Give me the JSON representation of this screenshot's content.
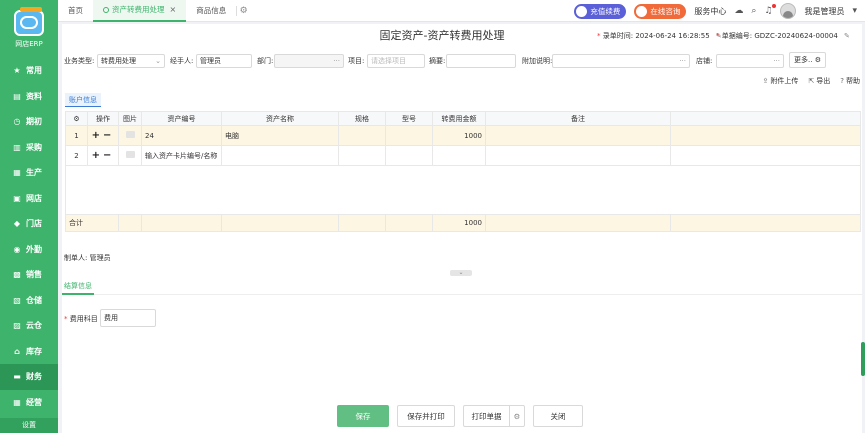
{
  "app": {
    "logo_text": "网店ERP",
    "settings_label": "设置"
  },
  "sidebar": {
    "items": [
      {
        "label": "常用",
        "icon": "star-icon",
        "glyph": "★"
      },
      {
        "label": "资料",
        "icon": "book-icon",
        "glyph": "▤"
      },
      {
        "label": "期初",
        "icon": "clock-icon",
        "glyph": "◷"
      },
      {
        "label": "采购",
        "icon": "cart-icon",
        "glyph": "▥"
      },
      {
        "label": "生产",
        "icon": "factory-icon",
        "glyph": "▦"
      },
      {
        "label": "网店",
        "icon": "shop-icon",
        "glyph": "▣"
      },
      {
        "label": "门店",
        "icon": "store-icon",
        "glyph": "◆"
      },
      {
        "label": "外勤",
        "icon": "compass-icon",
        "glyph": "◉"
      },
      {
        "label": "销售",
        "icon": "sales-icon",
        "glyph": "▩"
      },
      {
        "label": "仓储",
        "icon": "warehouse-icon",
        "glyph": "▧"
      },
      {
        "label": "云仓",
        "icon": "cloud-warehouse-icon",
        "glyph": "▨"
      },
      {
        "label": "库存",
        "icon": "inventory-icon",
        "glyph": "⌂"
      },
      {
        "label": "财务",
        "icon": "finance-icon",
        "glyph": "▬"
      },
      {
        "label": "经营",
        "icon": "chart-icon",
        "glyph": "▦"
      }
    ],
    "active_index": 12
  },
  "tabs": [
    {
      "label": "首页",
      "active": false
    },
    {
      "label": "资产转费用处理",
      "active": true
    },
    {
      "label": "商品信息",
      "active": false
    }
  ],
  "topbar": {
    "recharge_label": "充值续费",
    "online_consult_label": "在线咨询",
    "service_center_label": "服务中心",
    "user_name": "我是管理员"
  },
  "page": {
    "title": "固定资产-资产转费用处理",
    "entry_time_label": "录单时间:",
    "entry_time_value": "2024-06-24 16:28:55",
    "doc_no_label": "单据编号:",
    "doc_no_value": "GDZC-20240624-00004"
  },
  "form": {
    "business_type_label": "业务类型:",
    "business_type_value": "转费用处理",
    "handler_label": "经手人:",
    "handler_value": "管理员",
    "department_label": "部门:",
    "department_value": "",
    "project_label": "项目:",
    "project_placeholder": "请选择项目",
    "summary_label": "摘要:",
    "summary_value": "",
    "note_label": "附加说明:",
    "note_value": "",
    "shop_label": "店铺:",
    "shop_value": "",
    "more_label": "更多.."
  },
  "actions": {
    "attach_upload": "附件上传",
    "export": "导出",
    "help": "帮助"
  },
  "account_tab_label": "账户信息",
  "table": {
    "headers": [
      "操作",
      "图片",
      "资产编号",
      "资产名称",
      "规格",
      "型号",
      "转费用金额",
      "备注"
    ],
    "rows": [
      {
        "no": "1",
        "asset_no": "24",
        "asset_name": "电脑",
        "spec": "",
        "model": "",
        "amount": "1000",
        "remark": ""
      },
      {
        "no": "2",
        "asset_no_placeholder": "输入资产卡片编号/名称",
        "asset_name": "",
        "spec": "",
        "model": "",
        "amount": "",
        "remark": ""
      }
    ],
    "total_label": "合计",
    "total_amount": "1000"
  },
  "footer": {
    "maker_label": "制单人:",
    "maker_value": "管理员",
    "settle_tab_label": "结算信息",
    "fee_subject_label": "费用科目",
    "fee_subject_value": "费用"
  },
  "buttons": {
    "save": "保存",
    "save_print": "保存并打印",
    "print_doc": "打印单据",
    "close": "关闭"
  },
  "colors": {
    "brand": "#3db36b",
    "recharge": "#5b5fd8",
    "consult": "#f06a3a",
    "highlight_row": "#fdf6e3"
  }
}
